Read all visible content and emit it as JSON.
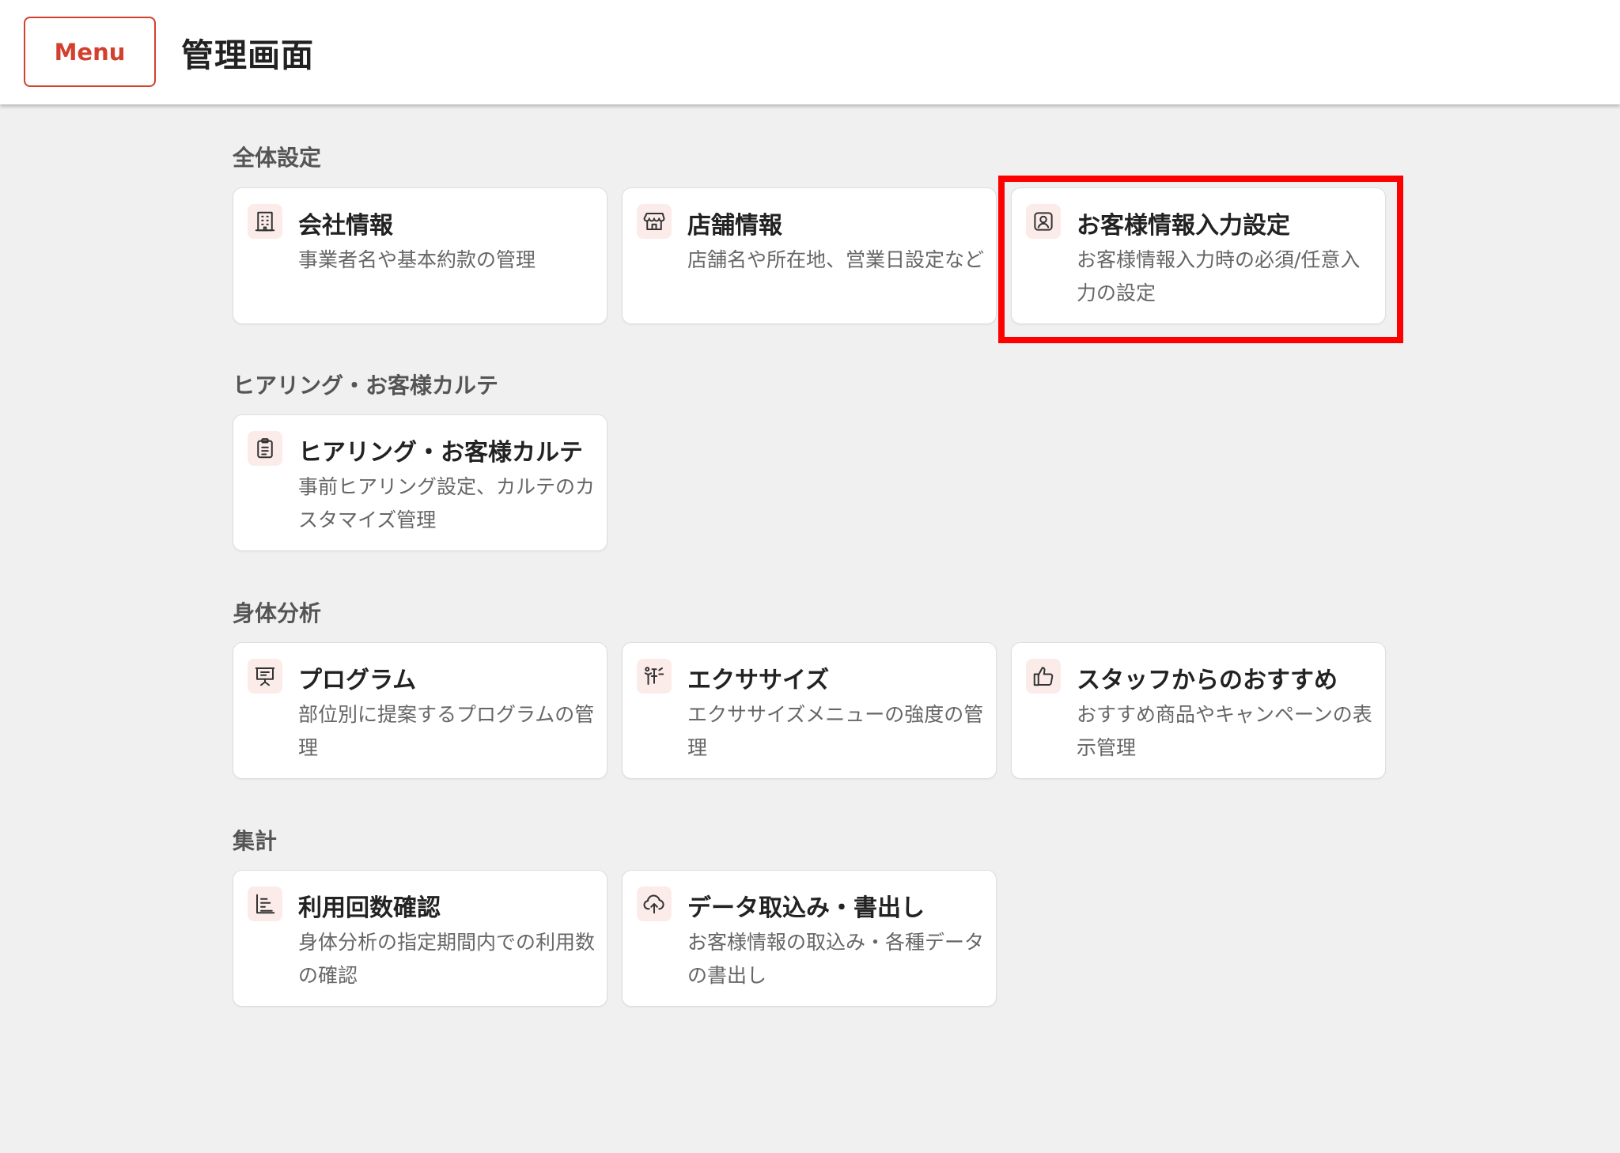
{
  "header": {
    "menu_label": "Menu",
    "title": "管理画面"
  },
  "colors": {
    "accent": "#d2402e",
    "icon_bg": "#fbecea",
    "highlight": "#ff0000"
  },
  "sections": [
    {
      "title": "全体設定",
      "cards": [
        {
          "icon": "building-icon",
          "title": "会社情報",
          "desc": "事業者名や基本約款の管理"
        },
        {
          "icon": "store-icon",
          "title": "店舗情報",
          "desc": "店舗名や所在地、営業日設定など"
        },
        {
          "icon": "user-portrait-icon",
          "title": "お客様情報入力設定",
          "desc": "お客様情報入力時の必須/任意入力の設定"
        }
      ]
    },
    {
      "title": "ヒアリング・お客様カルテ",
      "cards": [
        {
          "icon": "clipboard-icon",
          "title": "ヒアリング・お客様カルテ",
          "desc": "事前ヒアリング設定、カルテのカスタマイズ管理"
        }
      ]
    },
    {
      "title": "身体分析",
      "cards": [
        {
          "icon": "presentation-icon",
          "title": "プログラム",
          "desc": "部位別に提案するプログラムの管理"
        },
        {
          "icon": "exercise-icon",
          "title": "エクササイズ",
          "desc": "エクササイズメニューの強度の管理"
        },
        {
          "icon": "thumbs-up-icon",
          "title": "スタッフからのおすすめ",
          "desc": "おすすめ商品やキャンペーンの表示管理"
        }
      ]
    },
    {
      "title": "集計",
      "cards": [
        {
          "icon": "bar-chart-icon",
          "title": "利用回数確認",
          "desc": "身体分析の指定期間内での利用数の確認"
        },
        {
          "icon": "cloud-upload-icon",
          "title": "データ取込み・書出し",
          "desc": "お客様情報の取込み・各種データの書出し"
        }
      ]
    }
  ]
}
